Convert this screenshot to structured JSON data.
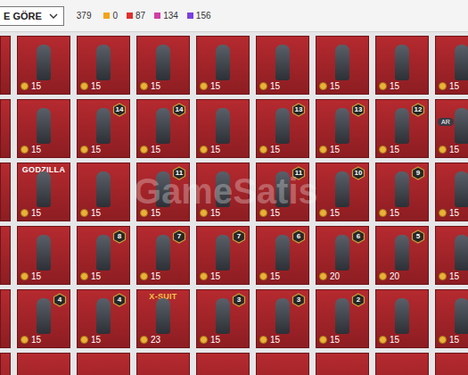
{
  "sort": {
    "label": "E GÖRE"
  },
  "total": "379",
  "rarities": [
    {
      "count": "0",
      "color": "#f2a31b"
    },
    {
      "count": "87",
      "color": "#e0302f"
    },
    {
      "count": "134",
      "color": "#d13ea6"
    },
    {
      "count": "156",
      "color": "#7b3fe0"
    }
  ],
  "watermark": "GameSatis",
  "grid": {
    "rows": [
      {
        "cards": [
          {
            "value": "15"
          },
          {
            "value": "15"
          },
          {
            "value": "15"
          },
          {
            "value": "15"
          },
          {
            "value": "15"
          },
          {
            "value": "15"
          },
          {
            "value": "15"
          },
          {
            "value": "15"
          }
        ]
      },
      {
        "cards": [
          {
            "value": "15"
          },
          {
            "value": "15",
            "badge": "14"
          },
          {
            "value": "15",
            "badge": "14"
          },
          {
            "value": "15"
          },
          {
            "value": "15",
            "badge": "13"
          },
          {
            "value": "15",
            "badge": "13"
          },
          {
            "value": "15",
            "badge": "12"
          },
          {
            "value": "15",
            "tag": "AR"
          }
        ]
      },
      {
        "cards": [
          {
            "value": "15",
            "label": {
              "text": "GODZILLA",
              "color": "#ffffff"
            }
          },
          {
            "value": "15"
          },
          {
            "value": "15",
            "badge": "11"
          },
          {
            "value": "15"
          },
          {
            "value": "15",
            "badge": "11"
          },
          {
            "value": "15",
            "badge": "10"
          },
          {
            "value": "15",
            "badge": "9"
          },
          {
            "value": "15"
          }
        ]
      },
      {
        "cards": [
          {
            "value": "15"
          },
          {
            "value": "15",
            "badge": "8"
          },
          {
            "value": "15",
            "badge": "7"
          },
          {
            "value": "15",
            "badge": "7"
          },
          {
            "value": "15",
            "badge": "6"
          },
          {
            "value": "20",
            "badge": "6"
          },
          {
            "value": "20",
            "badge": "5"
          },
          {
            "value": "15"
          }
        ]
      },
      {
        "cards": [
          {
            "value": "15",
            "badge": "4"
          },
          {
            "value": "15",
            "badge": "4"
          },
          {
            "value": "23",
            "label": {
              "text": "X-SUIT",
              "color": "#f3c64a"
            }
          },
          {
            "value": "15",
            "badge": "3"
          },
          {
            "value": "15",
            "badge": "3"
          },
          {
            "value": "15",
            "badge": "2"
          },
          {
            "value": "15"
          },
          {
            "value": "15"
          }
        ]
      }
    ]
  }
}
